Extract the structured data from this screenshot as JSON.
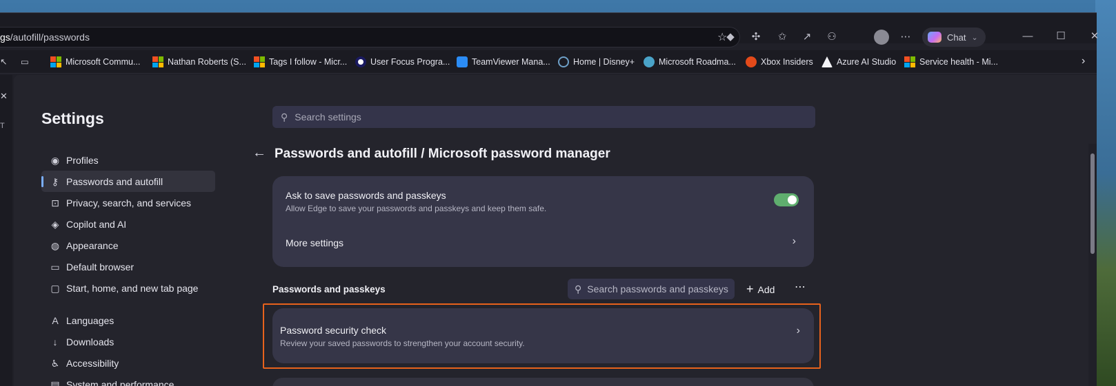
{
  "browser": {
    "url_prefix": "gs",
    "url_rest": "/autofill/passwords",
    "chat_label": "Chat"
  },
  "favorites": [
    {
      "label": "Microsoft Commu...",
      "icon": "microsoft-logo-icon"
    },
    {
      "label": "Nathan Roberts (S...",
      "icon": "microsoft-logo-icon"
    },
    {
      "label": "Tags I follow - Micr...",
      "icon": "microsoft-logo-icon"
    },
    {
      "label": "User Focus Progra...",
      "icon": "user-focus-icon"
    },
    {
      "label": "TeamViewer Mana...",
      "icon": "teamviewer-icon"
    },
    {
      "label": "Home | Disney+",
      "icon": "disney-icon"
    },
    {
      "label": "Microsoft Roadma...",
      "icon": "roadmap-icon"
    },
    {
      "label": "Xbox Insiders",
      "icon": "xbox-insiders-icon"
    },
    {
      "label": "Azure AI Studio",
      "icon": "azure-icon"
    },
    {
      "label": "Service health - Mi...",
      "icon": "microsoft-logo-icon"
    }
  ],
  "edge_strip": {
    "letter": "T"
  },
  "settings": {
    "title": "Settings",
    "search_placeholder": "Search settings",
    "nav": [
      {
        "label": "Profiles",
        "icon": "profile-icon"
      },
      {
        "label": "Passwords and autofill",
        "icon": "key-icon",
        "active": true
      },
      {
        "label": "Privacy, search, and services",
        "icon": "lock-icon"
      },
      {
        "label": "Copilot and AI",
        "icon": "copilot-icon"
      },
      {
        "label": "Appearance",
        "icon": "palette-icon"
      },
      {
        "label": "Default browser",
        "icon": "browser-icon"
      },
      {
        "label": "Start, home, and new tab page",
        "icon": "home-icon"
      },
      {
        "label": "Languages",
        "icon": "languages-icon"
      },
      {
        "label": "Downloads",
        "icon": "download-icon"
      },
      {
        "label": "Accessibility",
        "icon": "accessibility-icon"
      },
      {
        "label": "System and performance",
        "icon": "system-icon"
      }
    ],
    "page_title": "Passwords and autofill / Microsoft password manager",
    "ask_save_title": "Ask to save passwords and passkeys",
    "ask_save_desc": "Allow Edge to save your passwords and passkeys and keep them safe.",
    "ask_save_enabled": true,
    "more_settings": "More settings",
    "section_label": "Passwords and passkeys",
    "pw_search_placeholder": "Search passwords and passkeys",
    "add_label": "Add",
    "security_check_title": "Password security check",
    "security_check_desc": "Review your saved passwords to strengthen your account security."
  },
  "colors": {
    "accent": "#7aaeff",
    "toggle_on": "#5fae6e",
    "highlight": "#e8621c"
  }
}
